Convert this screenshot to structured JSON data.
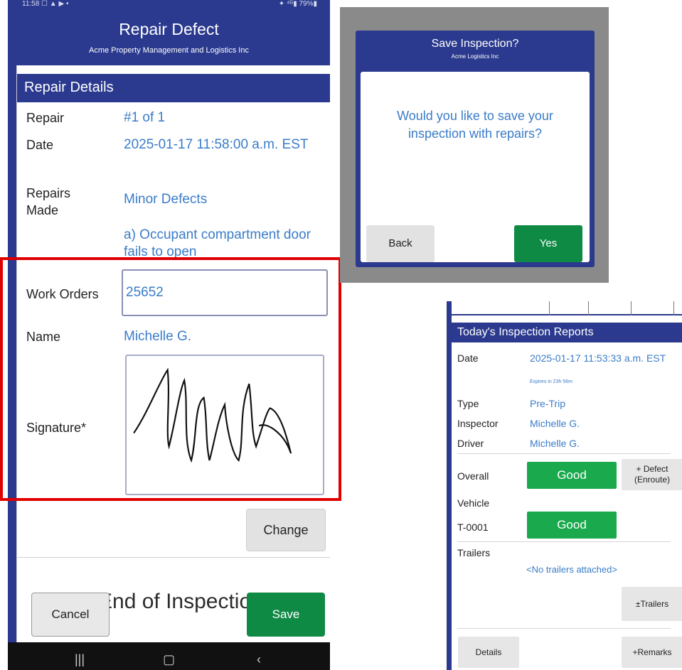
{
  "repair_screen": {
    "status_left": "11:58 ☐ ▲ ▶ •",
    "status_right": "✦ ⁴ᴳ▮ 79%▮",
    "title": "Repair Defect",
    "subtitle": "Acme Property Management and Logistics Inc",
    "section_header": "Repair Details",
    "repair_label": "Repair",
    "repair_value": "#1 of 1",
    "date_label": "Date",
    "date_value": "2025-01-17 11:58:00 a.m. EST",
    "repairs_made_label": "Repairs Made",
    "repairs_made_value": "Minor Defects",
    "defect_item": "a) Occupant compartment door fails to open",
    "work_orders_label": "Work Orders",
    "work_orders_value": "25652",
    "name_label": "Name",
    "name_value": "Michelle G.",
    "signature_label": "Signature*",
    "change_button": "Change",
    "end_text": "End of Inspection",
    "cancel_button": "Cancel",
    "save_button": "Save",
    "nav_recent": "|||",
    "nav_home": "▢",
    "nav_back": "‹"
  },
  "save_dialog": {
    "title": "Save Inspection?",
    "subtitle": "Acme Logistics Inc",
    "message": "Would you like to save your inspection with repairs?",
    "back_button": "Back",
    "yes_button": "Yes"
  },
  "reports_screen": {
    "header": "Today's Inspection Reports",
    "date_label": "Date",
    "date_value": "2025-01-17 11:53:33 a.m. EST",
    "expires": "Expires in 23h 56m",
    "type_label": "Type",
    "type_value": "Pre-Trip",
    "inspector_label": "Inspector",
    "inspector_value": "Michelle G.",
    "driver_label": "Driver",
    "driver_value": "Michelle G.",
    "overall_label": "Overall",
    "overall_status": "Good",
    "defect_button": "+ Defect (Enroute)",
    "vehicle_label": "Vehicle",
    "vehicle_id": "T-0001",
    "vehicle_status": "Good",
    "trailers_label": "Trailers",
    "no_trailers": "<No trailers attached>",
    "trailers_button": "±Trailers",
    "details_button": "Details",
    "remarks_button": "+Remarks"
  },
  "colors": {
    "header_blue": "#2b3a8e",
    "value_blue": "#3a7cc8",
    "green": "#0f8a45",
    "highlight_red": "#e00000"
  }
}
